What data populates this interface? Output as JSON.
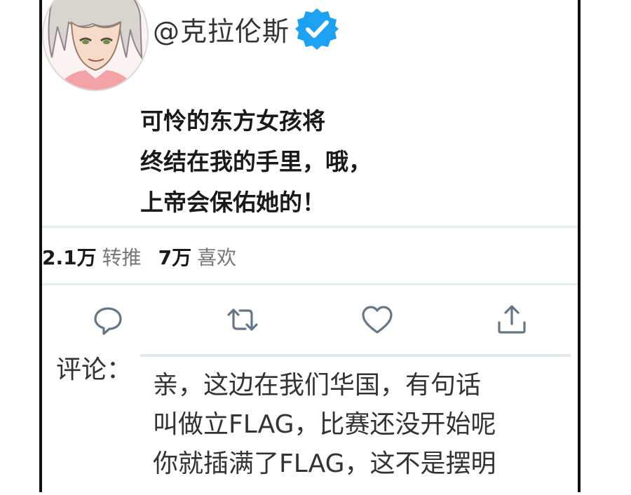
{
  "tweet": {
    "handle": "@克拉伦斯",
    "lines": [
      "可怜的东方女孩将",
      "终结在我的手里，哦，",
      "上帝会保佑她的！"
    ]
  },
  "stats": {
    "retweets_count": "2.1万",
    "retweets_label": "转推",
    "likes_count": "7万",
    "likes_label": "喜欢"
  },
  "actions": {
    "icons": [
      "reply-icon",
      "retweet-icon",
      "like-icon",
      "share-icon"
    ]
  },
  "comment": {
    "label": "评论：",
    "lines": [
      "亲，这边在我们华国，有句话",
      "叫做立FLAG，比赛还没开始呢",
      "你就插满了FLAG，这不是摆明"
    ]
  },
  "colors": {
    "verified_badge": "#1da1f2",
    "icon_gray": "#657786",
    "divider": "#e7ecef"
  }
}
